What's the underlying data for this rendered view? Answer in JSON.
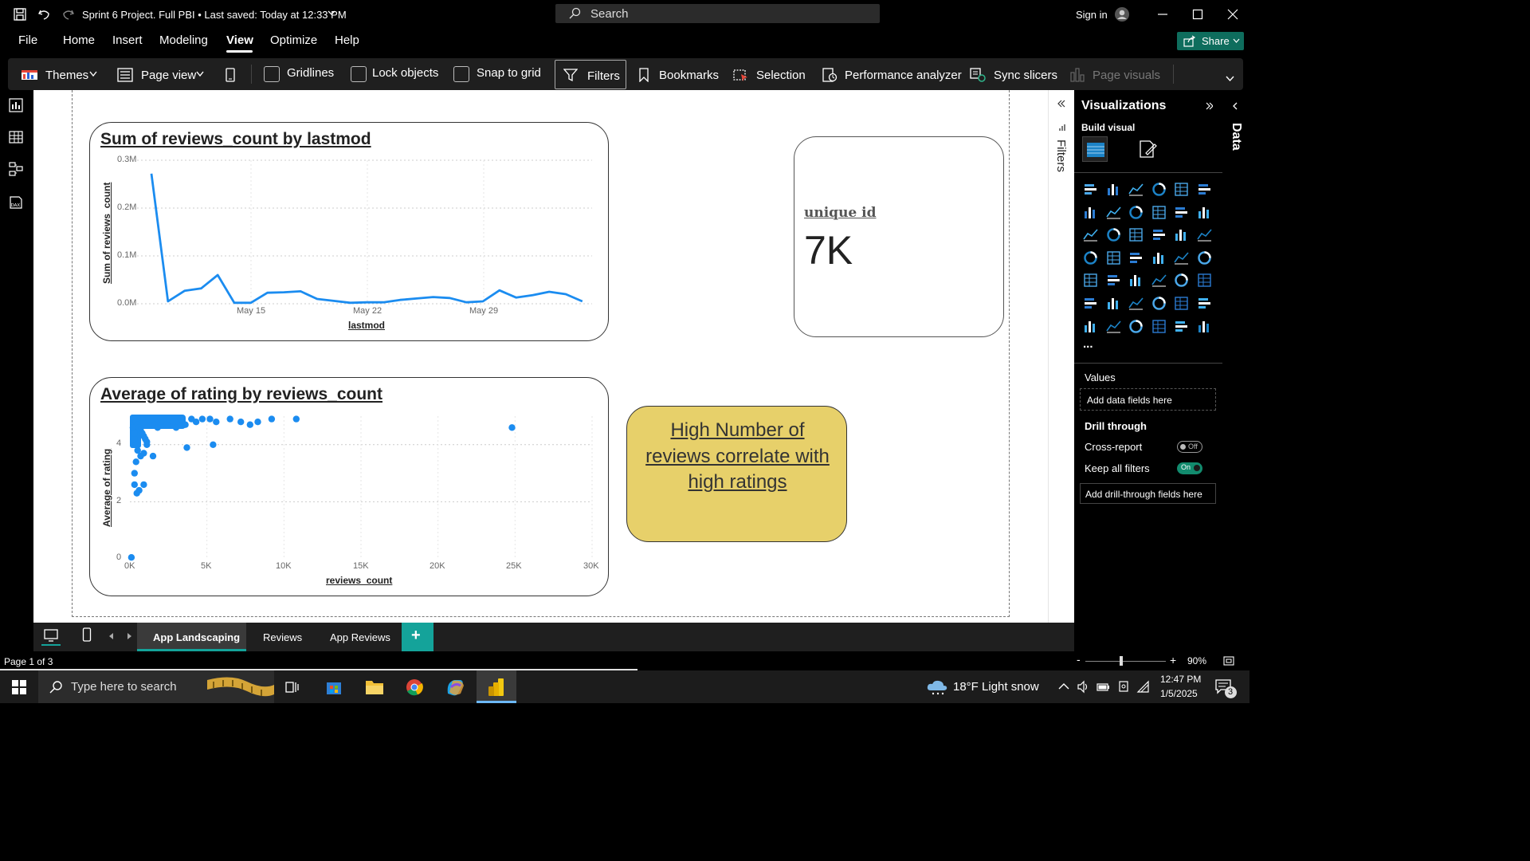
{
  "window": {
    "title": "Sprint 6 Project. Full PBI • Last saved: Today at 12:33 PM",
    "search_placeholder": "Search",
    "sign_in": "Sign in"
  },
  "menu": {
    "items": [
      "File",
      "Home",
      "Insert",
      "Modeling",
      "View",
      "Optimize",
      "Help"
    ],
    "active": "View",
    "share": "Share"
  },
  "ribbon": {
    "themes": "Themes",
    "page_view": "Page view",
    "gridlines": "Gridlines",
    "lock_objects": "Lock objects",
    "snap_to_grid": "Snap to grid",
    "filters": "Filters",
    "bookmarks": "Bookmarks",
    "selection": "Selection",
    "performance_analyzer": "Performance analyzer",
    "sync_slicers": "Sync slicers",
    "page_visuals": "Page visuals"
  },
  "line_visual": {
    "title": "Sum of reviews_count by lastmod",
    "xlabel": "lastmod",
    "ylabel": "Sum of reviews_count",
    "yticks": [
      "0.3M",
      "0.2M",
      "0.1M",
      "0.0M"
    ],
    "xticks": [
      "May 15",
      "May 22",
      "May 29"
    ]
  },
  "card_visual": {
    "label": "unique id",
    "value": "7K"
  },
  "scatter_visual": {
    "title": "Average of rating by reviews_count",
    "xlabel": "reviews_count",
    "ylabel": "Average of rating",
    "yticks": [
      "4",
      "2",
      "0"
    ],
    "xticks": [
      "0K",
      "5K",
      "10K",
      "15K",
      "20K",
      "25K",
      "30K"
    ]
  },
  "textbox": {
    "text": "High Number of reviews correlate with high ratings"
  },
  "filters_pane": {
    "label": "Filters"
  },
  "viz_pane": {
    "title": "Visualizations",
    "build_visual": "Build visual",
    "values": "Values",
    "add_data": "Add data fields here",
    "drill_through": "Drill through",
    "cross_report": "Cross-report",
    "cross_report_state": "Off",
    "keep_all_filters": "Keep all filters",
    "keep_state": "On",
    "add_drill": "Add drill-through fields here",
    "more": "..."
  },
  "data_pane": {
    "label": "Data"
  },
  "tabs": {
    "items": [
      "App Landscaping",
      "Reviews",
      "App Reviews"
    ],
    "active": "App Landscaping",
    "add": "+"
  },
  "status": {
    "page": "Page 1 of 3",
    "zoom": "90%"
  },
  "taskbar": {
    "search": "Type here to search",
    "weather": "18°F  Light snow",
    "time": "12:47 PM",
    "date": "1/5/2025",
    "notifications": "3"
  },
  "chart_data": [
    {
      "type": "line",
      "title": "Sum of reviews_count by lastmod",
      "xlabel": "lastmod",
      "ylabel": "Sum of reviews_count",
      "ylim": [
        0,
        300000
      ],
      "x": [
        "May 10",
        "May 11",
        "May 12",
        "May 13",
        "May 14",
        "May 15",
        "May 16",
        "May 17",
        "May 18",
        "May 19",
        "May 20",
        "May 21",
        "May 22",
        "May 23",
        "May 24",
        "May 25",
        "May 26",
        "May 27",
        "May 28",
        "May 29",
        "May 30",
        "May 31",
        "Jun 1",
        "Jun 2",
        "Jun 3",
        "Jun 4"
      ],
      "series": [
        {
          "values": [
            272000,
            5000,
            27000,
            32000,
            60000,
            2000,
            2000,
            23000,
            24000,
            26000,
            10000,
            6000,
            2000,
            3000,
            3000,
            8000,
            11000,
            14000,
            12000,
            3000,
            5000,
            28000,
            13000,
            18000,
            25000,
            20000,
            5000
          ]
        }
      ],
      "grid": true
    },
    {
      "type": "scatter",
      "title": "Average of rating by reviews_count",
      "xlabel": "reviews_count",
      "ylabel": "Average of rating",
      "xlim": [
        0,
        30000
      ],
      "ylim": [
        0,
        5
      ],
      "points": [
        [
          300,
          4.9
        ],
        [
          400,
          4.8
        ],
        [
          500,
          4.7
        ],
        [
          600,
          4.6
        ],
        [
          700,
          4.5
        ],
        [
          800,
          4.4
        ],
        [
          900,
          4.3
        ],
        [
          1000,
          4.2
        ],
        [
          1100,
          4.1
        ],
        [
          1200,
          4.9
        ],
        [
          1400,
          4.8
        ],
        [
          1600,
          4.7
        ],
        [
          1800,
          4.6
        ],
        [
          2000,
          4.9
        ],
        [
          2200,
          4.8
        ],
        [
          2400,
          4.7
        ],
        [
          2600,
          4.9
        ],
        [
          2800,
          4.8
        ],
        [
          3000,
          4.6
        ],
        [
          3300,
          4.9
        ],
        [
          3600,
          4.7
        ],
        [
          4000,
          4.9
        ],
        [
          4300,
          4.8
        ],
        [
          4700,
          4.9
        ],
        [
          5200,
          4.9
        ],
        [
          5600,
          4.8
        ],
        [
          6500,
          4.9
        ],
        [
          7200,
          4.8
        ],
        [
          7800,
          4.7
        ],
        [
          8300,
          4.8
        ],
        [
          9200,
          4.9
        ],
        [
          10800,
          4.9
        ],
        [
          24800,
          4.6
        ],
        [
          300,
          4.2
        ],
        [
          400,
          4.0
        ],
        [
          500,
          3.8
        ],
        [
          700,
          3.6
        ],
        [
          400,
          3.4
        ],
        [
          300,
          3.0
        ],
        [
          300,
          2.6
        ],
        [
          600,
          2.4
        ],
        [
          450,
          2.3
        ],
        [
          900,
          2.6
        ],
        [
          1500,
          3.6
        ],
        [
          3700,
          3.9
        ],
        [
          5400,
          4.0
        ],
        [
          900,
          3.7
        ],
        [
          1100,
          4.0
        ],
        [
          300,
          4.4
        ],
        [
          200,
          4.6
        ],
        [
          100,
          0.05
        ]
      ],
      "grid": true
    }
  ]
}
